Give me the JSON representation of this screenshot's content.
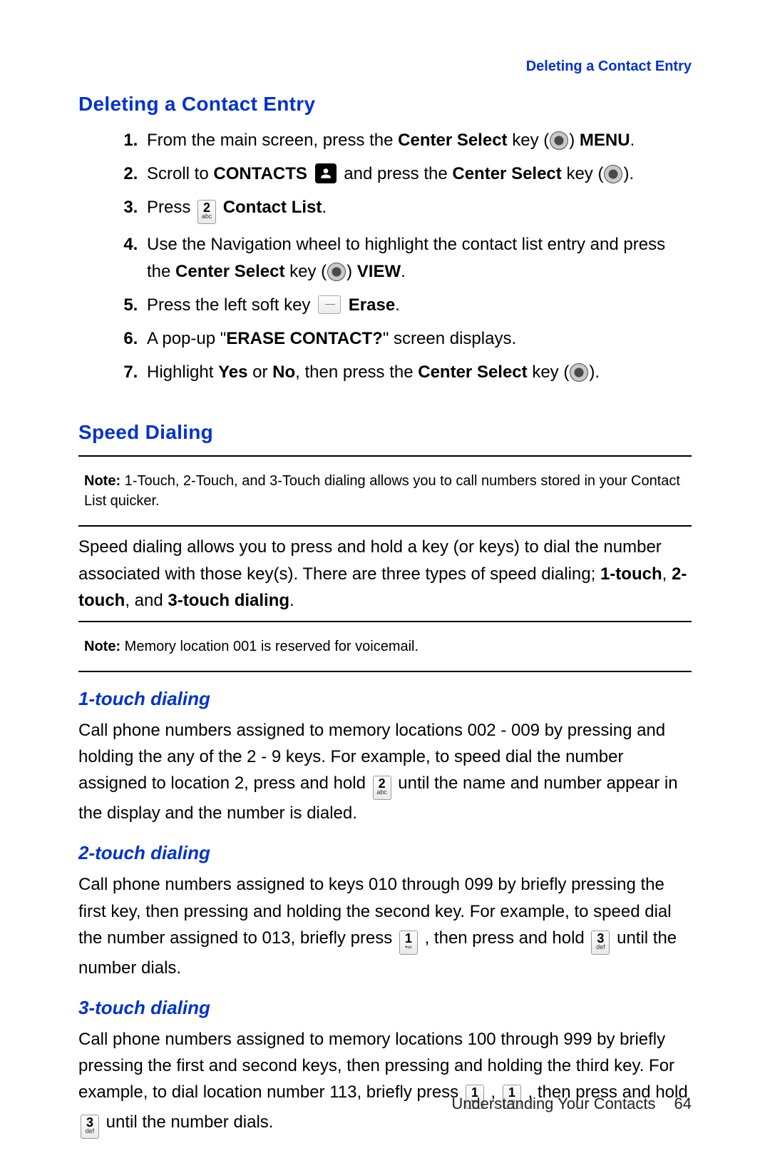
{
  "header": {
    "running_title": "Deleting a Contact Entry"
  },
  "sections": {
    "deleting": {
      "title": "Deleting a Contact Entry",
      "steps": {
        "s1_a": "From the main screen, press the ",
        "s1_b": "Center Select",
        "s1_c": " key (",
        "s1_d": ") ",
        "s1_e": "MENU",
        "s1_f": ".",
        "s2_a": "Scroll to ",
        "s2_b": "CONTACTS",
        "s2_c": " and press the ",
        "s2_d": "Center Select",
        "s2_e": " key (",
        "s2_f": ").",
        "s3_a": "Press ",
        "s3_b": "Contact List",
        "s3_c": ".",
        "s4_a": "Use the Navigation wheel to highlight the contact list entry and press the ",
        "s4_b": "Center Select",
        "s4_c": " key (",
        "s4_d": ") ",
        "s4_e": "VIEW",
        "s4_f": ".",
        "s5_a": "Press the left soft key ",
        "s5_b": "Erase",
        "s5_c": ".",
        "s6_a": "A pop-up \"",
        "s6_b": "ERASE CONTACT?",
        "s6_c": "\" screen displays.",
        "s7_a": "Highlight ",
        "s7_b": "Yes",
        "s7_c": " or ",
        "s7_d": "No",
        "s7_e": ", then press the ",
        "s7_f": "Center Select",
        "s7_g": " key (",
        "s7_h": ")."
      }
    },
    "speed": {
      "title": "Speed Dialing",
      "note1_label": "Note:",
      "note1_text": " 1-Touch, 2-Touch, and 3-Touch dialing allows you to call numbers stored in your Contact List quicker.",
      "para_a": "Speed dialing allows you to press and hold a key (or keys) to dial the number associated with those key(s). There are three types of speed dialing; ",
      "para_b": "1-touch",
      "para_c": ", ",
      "para_d": "2-touch",
      "para_e": ", and ",
      "para_f": "3-touch dialing",
      "para_g": ".",
      "note2_label": "Note:",
      "note2_text": " Memory location 001 is reserved for voicemail.",
      "one_touch": {
        "title": "1-touch dialing",
        "p_a": "Call phone numbers assigned to memory locations 002 - 009 by pressing and holding the any of the 2 - 9 keys. For example, to speed dial the number assigned to location 2, press and hold ",
        "p_b": " until the name and number appear in the display and the number is dialed."
      },
      "two_touch": {
        "title": "2-touch dialing",
        "p_a": "Call phone numbers assigned to keys 010 through 099 by briefly pressing the first key, then pressing and holding the second key. For example, to speed dial the number assigned to 013, briefly press ",
        "p_b": ", then press and hold ",
        "p_c": " until the number dials."
      },
      "three_touch": {
        "title": "3-touch dialing",
        "p_a": "Call phone numbers assigned to memory locations 100 through 999 by briefly pressing the first and second keys, then pressing and holding the third key. For example, to dial location number 113, briefly press ",
        "p_b": ", ",
        "p_c": ", then press and hold ",
        "p_d": " until the number dials."
      }
    }
  },
  "keys": {
    "k1_big": "1",
    "k1_small": "•∞",
    "k2_big": "2",
    "k2_small": "abc",
    "k3_big": "3",
    "k3_small": "def"
  },
  "footer": {
    "chapter": "Understanding Your Contacts",
    "page": "64"
  }
}
